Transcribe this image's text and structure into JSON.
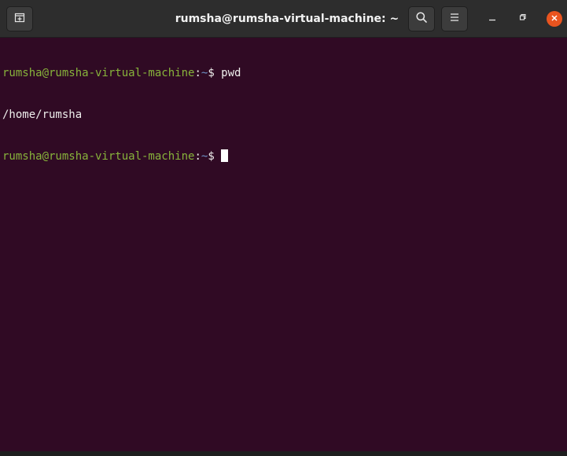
{
  "window": {
    "title": "rumsha@rumsha-virtual-machine: ~"
  },
  "titlebar": {
    "new_tab_icon": "new-tab-icon",
    "search_icon": "search-icon",
    "menu_icon": "hamburger-menu-icon",
    "minimize_icon": "minimize-icon",
    "maximize_icon": "maximize-icon",
    "close_icon": "close-icon"
  },
  "colors": {
    "background": "#300a24",
    "prompt_user": "#87b33b",
    "prompt_path": "#6f93c8",
    "text": "#eeeeec",
    "close_button": "#e9541f"
  },
  "terminal": {
    "lines": [
      {
        "user_host": "rumsha@rumsha-virtual-machine",
        "sep": ":",
        "path": "~",
        "symbol": "$ ",
        "command": "pwd"
      },
      {
        "output": "/home/rumsha"
      },
      {
        "user_host": "rumsha@rumsha-virtual-machine",
        "sep": ":",
        "path": "~",
        "symbol": "$ ",
        "command": ""
      }
    ]
  }
}
